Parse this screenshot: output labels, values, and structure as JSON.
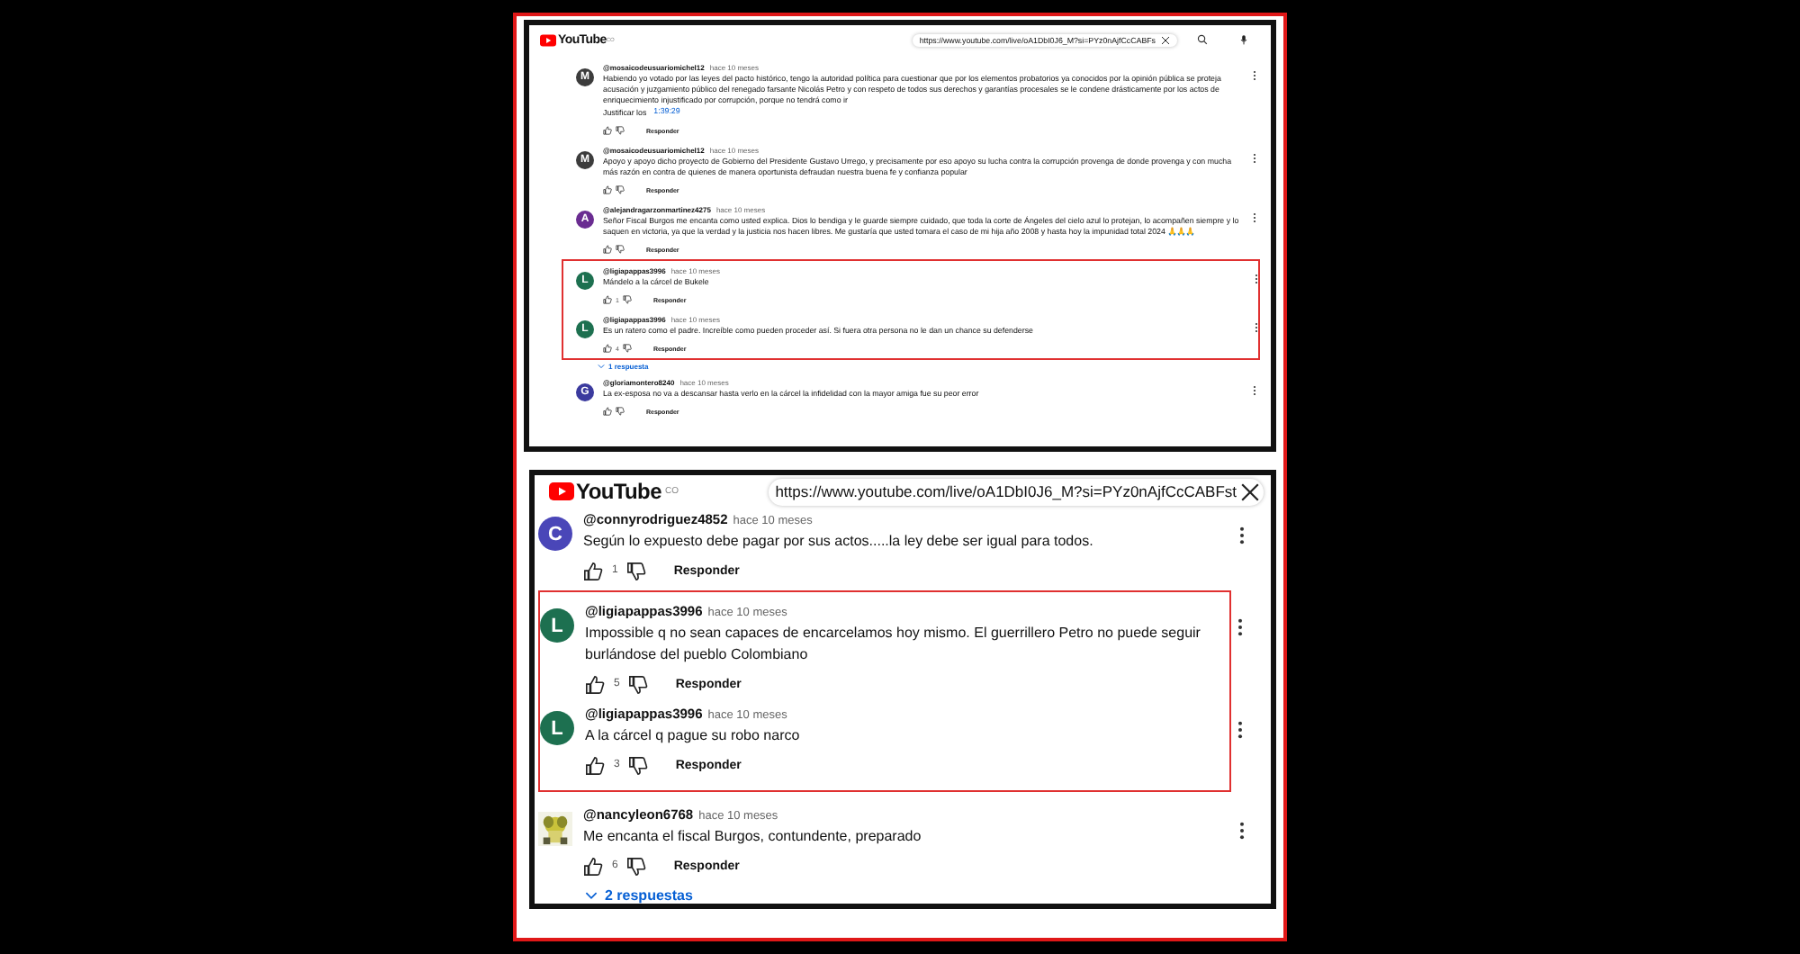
{
  "panels": [
    {
      "logo": "YouTube",
      "country": "CO",
      "url": "https://www.youtube.com/live/oA1DbI0J6_M?si=PYz0nAjfCcCABFs",
      "header_icons": [
        {
          "kind": "search"
        },
        {
          "kind": "mic"
        }
      ],
      "groups": [
        {
          "highlighted": false,
          "comments": [
            {
              "author": "@mosaicodeusuariomichel12",
              "time": "hace 10 meses",
              "text": "Habiendo yo votado por las leyes del pacto histórico, tengo la autoridad política para cuestionar que por los elementos probatorios ya conocidos por la opinión pública se proteja acusación y juzgamiento público del renegado farsante Nicolás Petro y con respeto de todos sus derechos y garantías procesales se le condene drásticamente por los actos de enriquecimiento injustificado por corrupción, porque no tendrá como ir",
              "footer": "Justificar los",
              "timestamp": "1:39:29",
              "reply": "Responder",
              "avatar": {
                "kind": "letter",
                "letter": "M",
                "color": "#3c3c3c"
              }
            },
            {
              "author": "@mosaicodeusuariomichel12",
              "time": "hace 10 meses",
              "text": "Apoyo y apoyo dicho proyecto de Gobierno del Presidente Gustavo Urrego, y precisamente por eso apoyo su lucha contra la corrupción provenga de donde provenga y con mucha más razón en contra de quienes de manera oportunista defraudan nuestra buena fe y confianza popular",
              "reply": "Responder",
              "avatar": {
                "kind": "letter",
                "letter": "M",
                "color": "#3c3c3c"
              }
            },
            {
              "author": "@alejandragarzonmartinez4275",
              "time": "hace 10 meses",
              "text": "Señor Fiscal Burgos me encanta como usted explica. Dios lo bendiga y le guarde siempre cuidado, que toda la corte de Ángeles del cielo azul lo protejan, lo acompañen siempre y lo saquen en victoria, ya que la verdad y la justicia nos hacen libres. Me gustaría que usted tomara el caso de mi hija año 2008 y hasta hoy la impunidad total 2024 🙏🙏🙏",
              "reply": "Responder",
              "avatar": {
                "kind": "letter",
                "letter": "A",
                "color": "#6a2c91"
              }
            }
          ]
        },
        {
          "highlighted": true,
          "comments": [
            {
              "author": "@ligiapappas3996",
              "time": "hace 10 meses",
              "text": "Mándelo a la cárcel de Bukele",
              "likes": "1",
              "reply": "Responder",
              "avatar": {
                "kind": "letter",
                "letter": "L",
                "color": "#1d7050"
              }
            },
            {
              "author": "@ligiapappas3996",
              "time": "hace 10 meses",
              "text": "Es un ratero como el padre. Increíble como pueden proceder así. Si fuera otra persona no le dan un chance su defenderse",
              "likes": "4",
              "reply": "Responder",
              "avatar": {
                "kind": "letter",
                "letter": "L",
                "color": "#1d7050"
              }
            }
          ],
          "replies": "1 respuesta"
        },
        {
          "highlighted": false,
          "comments": [
            {
              "author": "@gloriamontero8240",
              "time": "hace 10 meses",
              "text": "La ex-esposa no va a descansar hasta verlo en la cárcel la infidelidad con la mayor amiga fue su peor error",
              "reply": "Responder",
              "avatar": {
                "kind": "letter",
                "letter": "G",
                "color": "#3b3a9e"
              }
            }
          ]
        }
      ]
    },
    {
      "logo": "YouTube",
      "country": "CO",
      "url": "https://www.youtube.com/live/oA1DbI0J6_M?si=PYz0nAjfCcCABFst",
      "groups": [
        {
          "highlighted": false,
          "comments": [
            {
              "author": "@connyrodriguez4852",
              "time": "hace 10 meses",
              "text": "Según lo expuesto debe pagar por sus actos.....la ley debe ser igual para todos.",
              "likes": "1",
              "reply": "Responder",
              "avatar": {
                "kind": "letter",
                "letter": "C",
                "color": "#4a46b8"
              }
            }
          ]
        },
        {
          "highlighted": true,
          "comments": [
            {
              "author": "@ligiapappas3996",
              "time": "hace 10 meses",
              "text": "Impossible q no sean capaces de encarcelamos hoy mismo. El guerrillero Petro no puede seguir burlándose del pueblo Colombiano",
              "likes": "5",
              "reply": "Responder",
              "avatar": {
                "kind": "letter",
                "letter": "L",
                "color": "#1d7050"
              }
            },
            {
              "author": "@ligiapappas3996",
              "time": "hace 10 meses",
              "text": "A la cárcel q pague su robo narco",
              "likes": "3",
              "reply": "Responder",
              "avatar": {
                "kind": "letter",
                "letter": "L",
                "color": "#1d7050"
              }
            }
          ]
        },
        {
          "highlighted": false,
          "comments": [
            {
              "author": "@nancyleon6768",
              "time": "hace 10 meses",
              "text": "Me encanta el fiscal Burgos, contundente, preparado",
              "likes": "6",
              "reply": "Responder"
            }
          ],
          "replies": "2 respuestas"
        }
      ]
    }
  ]
}
